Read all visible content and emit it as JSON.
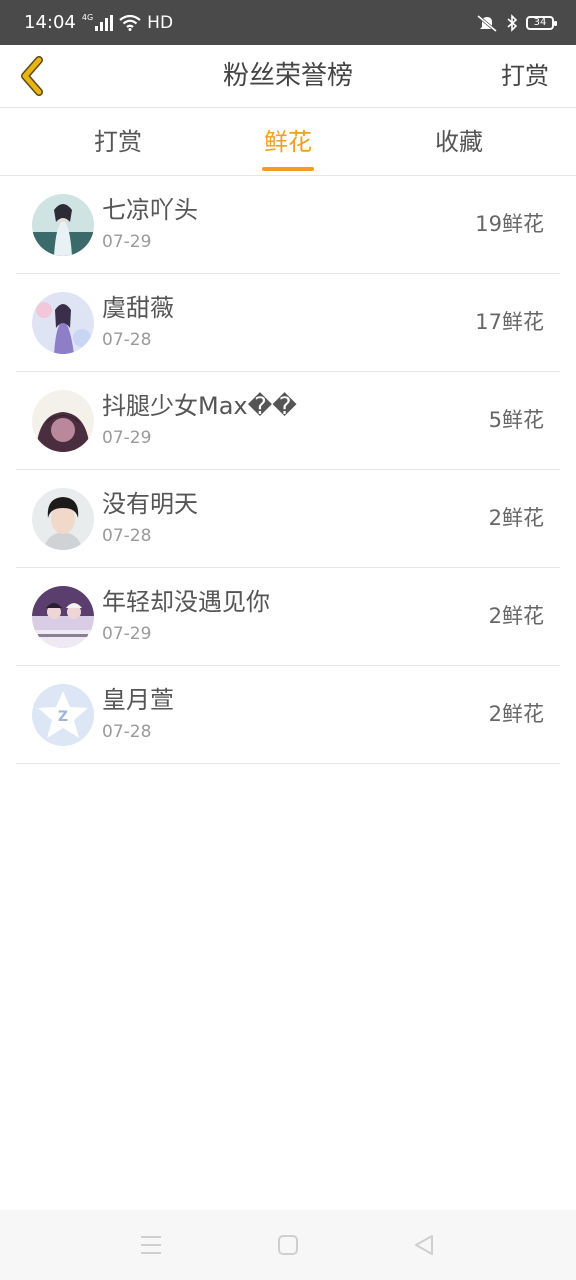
{
  "status_bar": {
    "time": "14:04",
    "network": "4G",
    "hd": "HD",
    "battery": "34"
  },
  "header": {
    "title": "粉丝荣誉榜",
    "action": "打赏"
  },
  "tabs": [
    {
      "label": "打赏",
      "active": false
    },
    {
      "label": "鲜花",
      "active": true
    },
    {
      "label": "收藏",
      "active": false
    }
  ],
  "list": [
    {
      "name": "七凉吖头",
      "date": "07-29",
      "count": "19鲜花"
    },
    {
      "name": "虞甜薇",
      "date": "07-28",
      "count": "17鲜花"
    },
    {
      "name": "抖腿少女Max��",
      "date": "07-29",
      "count": "5鲜花"
    },
    {
      "name": "没有明天",
      "date": "07-28",
      "count": "2鲜花"
    },
    {
      "name": "年轻却没遇见你",
      "date": "07-29",
      "count": "2鲜花"
    },
    {
      "name": "皇月萱",
      "date": "07-28",
      "count": "2鲜花"
    }
  ],
  "colors": {
    "accent": "#f0a01e",
    "status_bar": "#4a4a4a",
    "back_arrow": "#e9b416"
  }
}
